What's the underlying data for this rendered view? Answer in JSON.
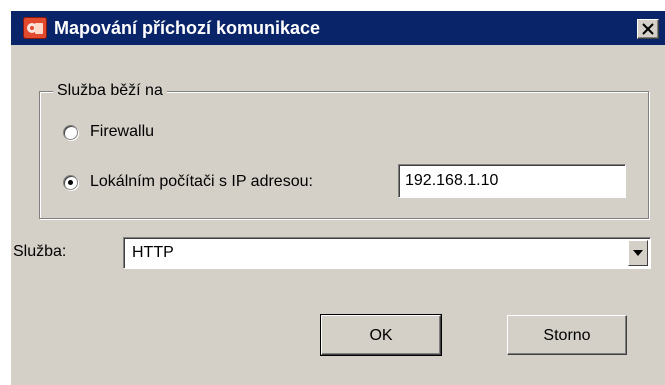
{
  "window": {
    "title": "Mapování příchozí komunikace"
  },
  "group": {
    "legend": "Služba běží na",
    "options": [
      {
        "label": "Firewallu",
        "checked": false
      },
      {
        "label": "Lokálním počítači s IP adresou:",
        "checked": true
      }
    ],
    "ip_address": "192.168.1.10"
  },
  "service": {
    "label": "Služba:",
    "value": "HTTP"
  },
  "buttons": {
    "ok": "OK",
    "cancel": "Storno"
  },
  "icons": {
    "app": "app-icon",
    "close": "close-icon",
    "dropdown": "chevron-down-icon"
  }
}
